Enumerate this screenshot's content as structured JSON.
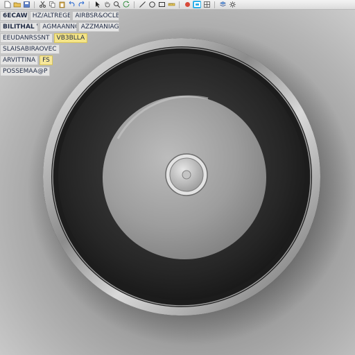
{
  "toolbar": {
    "buttons": [
      {
        "name": "new-file-icon"
      },
      {
        "name": "open-folder-icon"
      },
      {
        "name": "save-icon"
      },
      {
        "name": "cut-icon"
      },
      {
        "name": "copy-icon"
      },
      {
        "name": "paste-icon"
      },
      {
        "name": "undo-icon"
      },
      {
        "name": "redo-icon"
      },
      {
        "name": "select-arrow-icon"
      },
      {
        "name": "pan-hand-icon"
      },
      {
        "name": "zoom-icon"
      },
      {
        "name": "rotate-icon"
      },
      {
        "name": "line-icon"
      },
      {
        "name": "circle-icon"
      },
      {
        "name": "rectangle-icon"
      },
      {
        "name": "measure-icon"
      },
      {
        "name": "render-icon"
      },
      {
        "name": "view-icon",
        "active": true
      },
      {
        "name": "grid-icon"
      },
      {
        "name": "layers-icon"
      },
      {
        "name": "settings-icon"
      }
    ]
  },
  "panel": {
    "rows": [
      [
        "6ECAW",
        "HZ/ALTREGE",
        "AIRBSR&OCLB"
      ],
      [
        "BILITHAL V",
        "AGMAANNG",
        "AZZMANIAGS"
      ],
      [
        "EEUDANRSSNT",
        "VB3BLLA"
      ],
      [
        "SLAISABIRAOVEC"
      ],
      [
        "ARVITTINA",
        "FS"
      ],
      [
        "POSSEMAA@P"
      ]
    ]
  },
  "colors": {
    "background": "#8f8f8f",
    "rim": "#c8c8c8",
    "tire": "#1e1e1e",
    "hub": "#a9a9a9",
    "accent": "#2fb1ea",
    "note_yellow": "#f4e487"
  }
}
